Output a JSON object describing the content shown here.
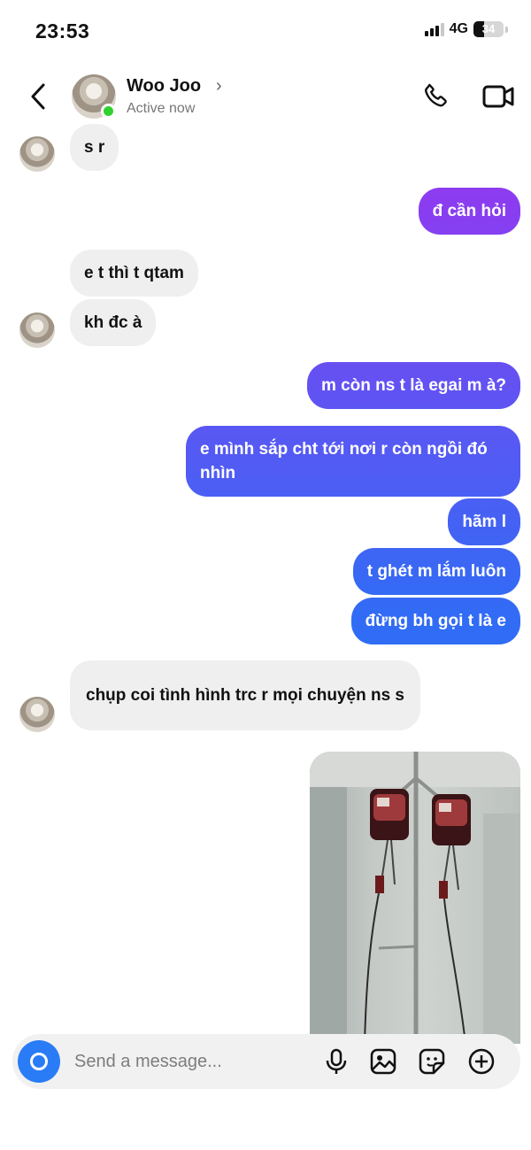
{
  "status_bar": {
    "time": "23:53",
    "network": "4G",
    "battery": "34",
    "battery_level": 0.34
  },
  "header": {
    "name": "Woo Joo",
    "chevron": "›",
    "status": "Active now"
  },
  "messages": [
    {
      "dir": "in",
      "text": "s r"
    },
    {
      "dir": "out",
      "text": "đ cần hỏi"
    },
    {
      "dir": "in",
      "text": "e t thì t qtam"
    },
    {
      "dir": "in",
      "text": "kh đc à"
    },
    {
      "dir": "out",
      "text": "m còn ns t là egai m à?"
    },
    {
      "dir": "out",
      "text": "e mình sắp cht tới nơi r còn ngồi đó nhìn"
    },
    {
      "dir": "out",
      "text": "hãm l"
    },
    {
      "dir": "out",
      "text": "t ghét m lắm luôn"
    },
    {
      "dir": "out",
      "text": "đừng bh gọi t là e"
    },
    {
      "dir": "in",
      "text": "chụp coi tình hình trc r mọi chuyện ns s"
    }
  ],
  "composer": {
    "placeholder": "Send a message..."
  },
  "icons": {
    "back": "chevron-left-icon",
    "call": "phone-icon",
    "video": "video-camera-icon",
    "camera": "camera-icon",
    "mic": "microphone-icon",
    "gallery": "image-icon",
    "sticker": "sticker-icon",
    "more": "plus-circle-icon"
  },
  "colors": {
    "out_top": "#8e3bf0",
    "out_bottom": "#2f6df5",
    "incoming": "#efefef",
    "online": "#2fd12e",
    "camera_button": "#2a7cf6"
  }
}
